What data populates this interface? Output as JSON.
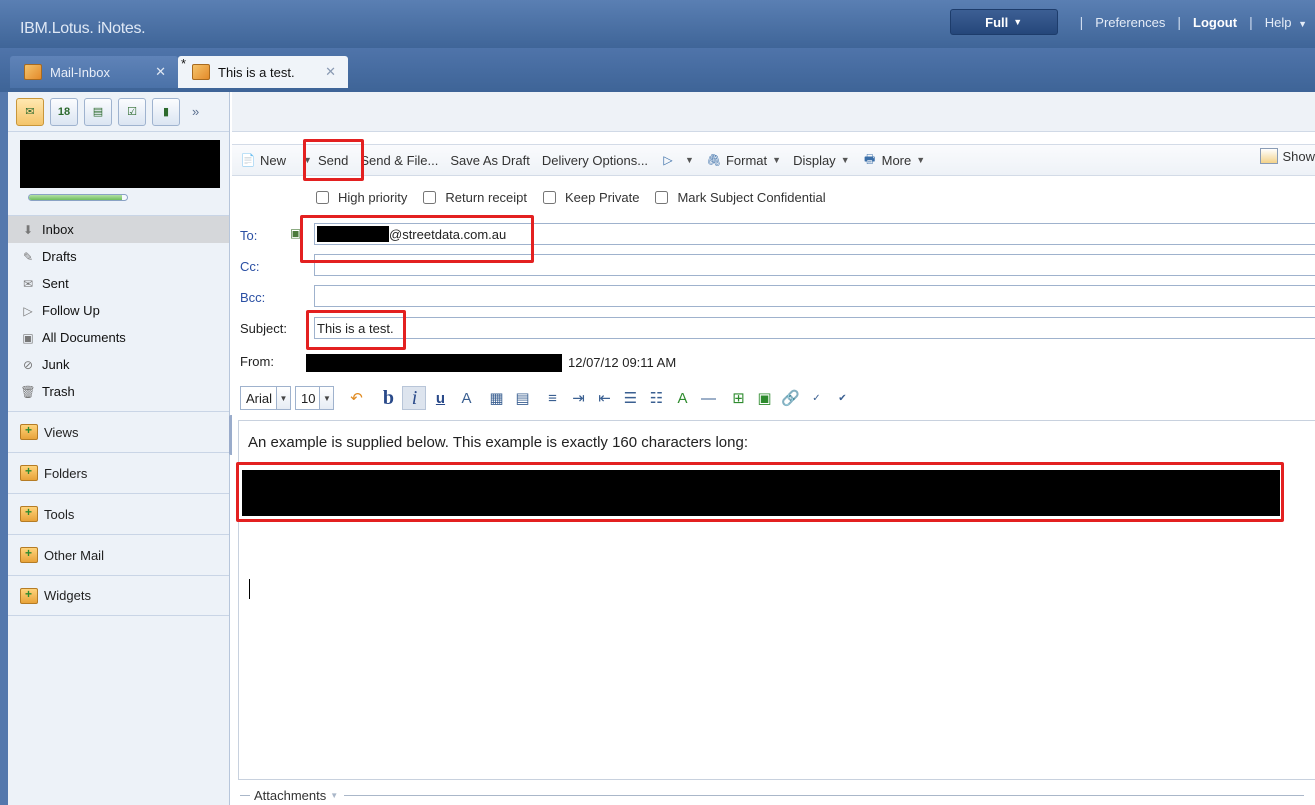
{
  "app": {
    "title": "IBM.Lotus. iNotes."
  },
  "topnav": {
    "mode": "Full",
    "preferences": "Preferences",
    "logout": "Logout",
    "help": "Help"
  },
  "tabs": [
    {
      "label": "Mail-Inbox",
      "unsaved": false
    },
    {
      "label": "This is a test.",
      "unsaved": true,
      "unsaved_marker": "*"
    }
  ],
  "sidebar": {
    "quota_level": 0.95,
    "calendar_day": "18",
    "items": [
      {
        "label": "Inbox",
        "icon": "inbox-icon",
        "selected": true
      },
      {
        "label": "Drafts",
        "icon": "drafts-icon"
      },
      {
        "label": "Sent",
        "icon": "sent-icon"
      },
      {
        "label": "Follow Up",
        "icon": "follow-up-flag-icon"
      },
      {
        "label": "All Documents",
        "icon": "all-documents-icon"
      },
      {
        "label": "Junk",
        "icon": "junk-icon"
      },
      {
        "label": "Trash",
        "icon": "trash-icon"
      }
    ],
    "sections": [
      "Views",
      "Folders",
      "Tools",
      "Other Mail",
      "Widgets"
    ]
  },
  "actions": {
    "new": "New",
    "send": "Send",
    "send_file": "Send & File...",
    "save_draft": "Save As Draft",
    "delivery": "Delivery Options...",
    "format": "Format",
    "display": "Display",
    "more": "More",
    "show": "Show"
  },
  "options": {
    "high_priority": "High priority",
    "return_receipt": "Return receipt",
    "keep_private": "Keep Private",
    "mark_confidential": "Mark Subject Confidential"
  },
  "fields": {
    "to_label": "To:",
    "to_value": "@streetdata.com.au",
    "cc_label": "Cc:",
    "bcc_label": "Bcc:",
    "subject_label": "Subject:",
    "subject_value": "This is a test.",
    "from_label": "From:",
    "date": "12/07/12 09:11 AM"
  },
  "editor": {
    "font": "Arial",
    "size": "10",
    "body_text": "An example is supplied below. This example is exactly 160 characters long:",
    "attachments_label": "Attachments"
  },
  "colors": {
    "header": "#4a6fa5",
    "highlight_box": "#e32020",
    "sidebar_bg": "#edf2f8"
  }
}
